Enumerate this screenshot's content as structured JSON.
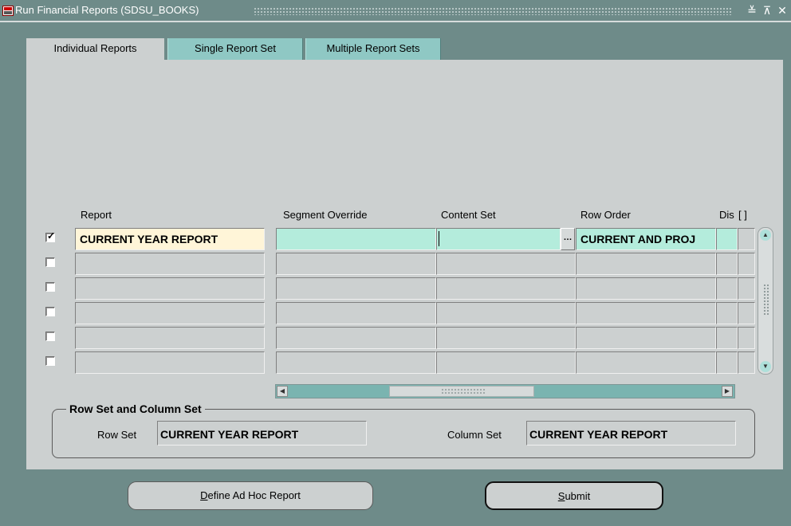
{
  "window": {
    "title": "Run Financial Reports (SDSU_BOOKS)",
    "controls": [
      "≚",
      "⊼",
      "✕"
    ]
  },
  "tabs": [
    {
      "label": "Individual Reports",
      "active": true
    },
    {
      "label": "Single Report Set",
      "active": false
    },
    {
      "label": "Multiple Report Sets",
      "active": false
    }
  ],
  "table": {
    "headers": {
      "report": "Report",
      "segment_override": "Segment Override",
      "content_set": "Content Set",
      "row_order": "Row Order",
      "display": "Dis",
      "extra": "[ ]"
    },
    "lov_button": "…",
    "rows": [
      {
        "checked": true,
        "check_mark": "✓",
        "report": "CURRENT YEAR REPORT",
        "segment_override": "",
        "content_set": "",
        "row_order": "CURRENT AND PROJ"
      },
      {
        "checked": false,
        "check_mark": "",
        "report": "",
        "segment_override": "",
        "content_set": "",
        "row_order": ""
      },
      {
        "checked": false,
        "check_mark": "",
        "report": "",
        "segment_override": "",
        "content_set": "",
        "row_order": ""
      },
      {
        "checked": false,
        "check_mark": "",
        "report": "",
        "segment_override": "",
        "content_set": "",
        "row_order": ""
      },
      {
        "checked": false,
        "check_mark": "",
        "report": "",
        "segment_override": "",
        "content_set": "",
        "row_order": ""
      },
      {
        "checked": false,
        "check_mark": "",
        "report": "",
        "segment_override": "",
        "content_set": "",
        "row_order": ""
      }
    ]
  },
  "row_column_set": {
    "legend": "Row Set and Column Set",
    "row_set_label": "Row Set",
    "row_set_value": "CURRENT YEAR REPORT",
    "column_set_label": "Column Set",
    "column_set_value": "CURRENT YEAR REPORT"
  },
  "buttons": {
    "define_mnemonic": "D",
    "define_rest": "efine Ad Hoc Report",
    "submit_mnemonic": "S",
    "submit_rest": "ubmit"
  },
  "colors": {
    "background": "#6e8b89",
    "panel": "#ccd0d0",
    "current_record": "#fff5d8",
    "required_field": "#b4ecdc",
    "inactive_tab": "#8fc8c4"
  }
}
